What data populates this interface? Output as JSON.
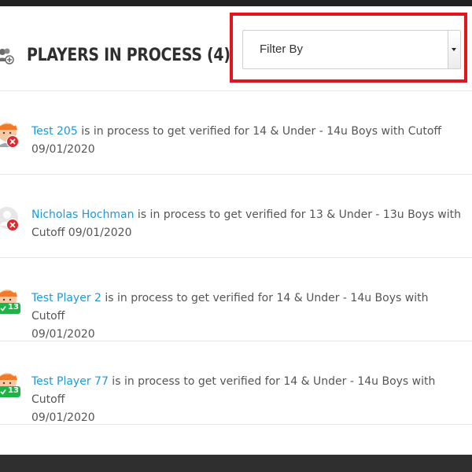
{
  "header": {
    "title": "PLAYERS IN PROCESS (4)",
    "icon": "users-add-icon"
  },
  "filter": {
    "selected": "Filter By"
  },
  "colors": {
    "link": "#1e9ad6",
    "highlight_border": "#e3141d",
    "rejected_badge": "#e0282f",
    "age_badge": "#1db446"
  },
  "players": [
    {
      "name": "Test 205",
      "middle": " is in process to get verified for 14 & Under - 14u Boys with Cutoff",
      "tail": "09/01/2020",
      "avatar": "orange-hair-avatar",
      "badge": "rejected",
      "badge_text": ""
    },
    {
      "name": "Nicholas Hochman",
      "middle": " is in process to get verified for 13 & Under - 13u Boys with",
      "tail": "Cutoff 09/01/2020",
      "avatar": "default-avatar",
      "badge": "rejected",
      "badge_text": ""
    },
    {
      "name": "Test Player 2",
      "middle": " is in process to get verified for 14 & Under - 14u Boys with Cutoff",
      "tail": "09/01/2020",
      "avatar": "orange-hair-avatar",
      "badge": "age",
      "badge_text": "13"
    },
    {
      "name": "Test Player 77",
      "middle": " is in process to get verified for 14 & Under - 14u Boys with Cutoff",
      "tail": "09/01/2020",
      "avatar": "orange-hair-avatar",
      "badge": "age",
      "badge_text": "13"
    }
  ]
}
